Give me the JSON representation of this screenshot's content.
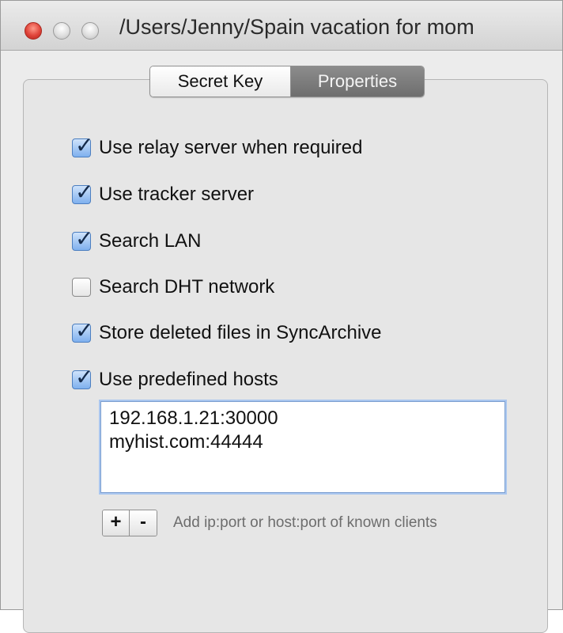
{
  "window": {
    "title": "/Users/Jenny/Spain vacation for mom"
  },
  "tabs": [
    {
      "label": "Secret Key",
      "active": false
    },
    {
      "label": "Properties",
      "active": true
    }
  ],
  "options": [
    {
      "label": "Use relay server when required",
      "checked": true
    },
    {
      "label": "Use tracker server",
      "checked": true
    },
    {
      "label": "Search LAN",
      "checked": true
    },
    {
      "label": "Search DHT network",
      "checked": false
    },
    {
      "label": "Store deleted files in SyncArchive",
      "checked": true
    },
    {
      "label": "Use predefined hosts",
      "checked": true
    }
  ],
  "hosts": {
    "entries": [
      "192.168.1.21:30000",
      "myhist.com:44444"
    ],
    "add_label": "+",
    "remove_label": "-",
    "hint": "Add ip:port or host:port of known clients"
  },
  "colors": {
    "close_button": "#e0443a",
    "active_tab": "#7d7d7d",
    "checkbox_checked": "#7fb0ee",
    "focus_ring": "#a9c6ef"
  },
  "icons": {
    "checkmark": "✓"
  }
}
